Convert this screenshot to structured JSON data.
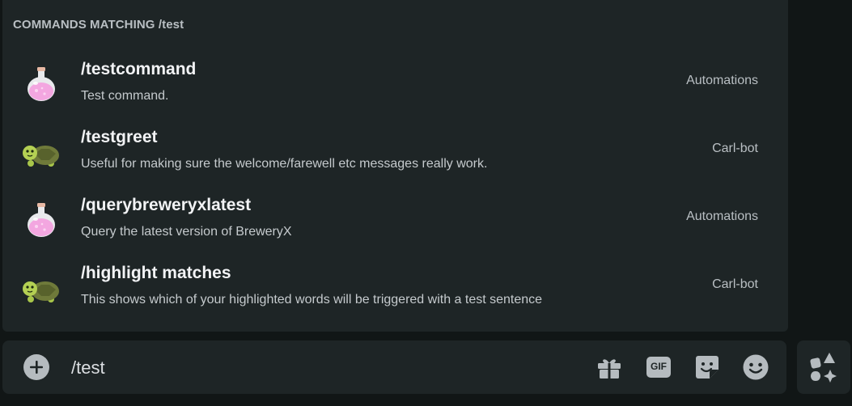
{
  "popup": {
    "header": "COMMANDS MATCHING /test",
    "commands": [
      {
        "name": "/testcommand",
        "description": "Test command.",
        "source": "Automations",
        "icon": "potion-icon"
      },
      {
        "name": "/testgreet",
        "description": "Useful for making sure the welcome/farewell etc messages really work.",
        "source": "Carl-bot",
        "icon": "turtle-icon"
      },
      {
        "name": "/querybreweryxlatest",
        "description": "Query the latest version of BreweryX",
        "source": "Automations",
        "icon": "potion-icon"
      },
      {
        "name": "/highlight matches",
        "description": "This shows which of your highlighted words will be triggered with a test sentence",
        "source": "Carl-bot",
        "icon": "turtle-icon"
      }
    ]
  },
  "input_bar": {
    "value": "/test",
    "gif_label": "GIF",
    "icons": [
      "plus-icon",
      "gift-icon",
      "gif-icon",
      "sticker-icon",
      "emoji-icon",
      "apps-icon"
    ]
  }
}
